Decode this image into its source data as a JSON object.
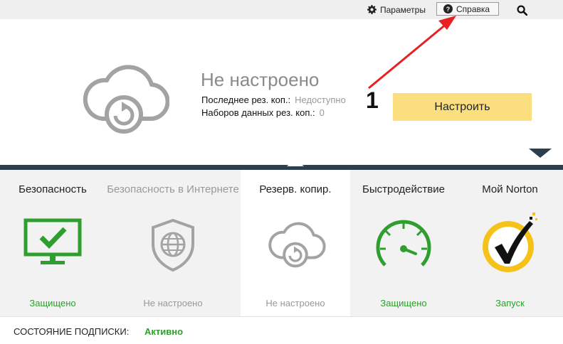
{
  "topbar": {
    "settings_label": "Параметры",
    "help_label": "Справка",
    "icons": {
      "settings": "gear-icon",
      "help": "question-circle-icon",
      "search": "search-icon"
    }
  },
  "hero": {
    "status_title": "Не настроено",
    "last_backup_label": "Последнее рез. коп.:",
    "last_backup_value": "Недоступно",
    "datasets_label": "Наборов данных рез. коп.:",
    "datasets_value": "0",
    "configure_button": "Настроить",
    "annotation_marker": "1"
  },
  "tiles": [
    {
      "title": "Безопасность",
      "status": "Защищено",
      "icon": "monitor-check-icon"
    },
    {
      "title": "Безопасность в Интернете",
      "status": "Не настроено",
      "icon": "globe-shield-icon"
    },
    {
      "title": "Резерв. копир.",
      "status": "Не настроено",
      "icon": "cloud-backup-icon"
    },
    {
      "title": "Быстродействие",
      "status": "Защищено",
      "icon": "speedometer-icon"
    },
    {
      "title": "Мой Norton",
      "status": "Запуск",
      "icon": "norton-logo-icon"
    }
  ],
  "subscription": {
    "label": "СОСТОЯНИЕ ПОДПИСКИ:",
    "value": "Активно"
  },
  "colors": {
    "accent_yellow": "#fbdf7f",
    "status_green": "#2e9e2e",
    "divider_navy": "#2d3e4c",
    "annotation_red": "#e8201f",
    "muted_gray": "#9a9a9a"
  }
}
